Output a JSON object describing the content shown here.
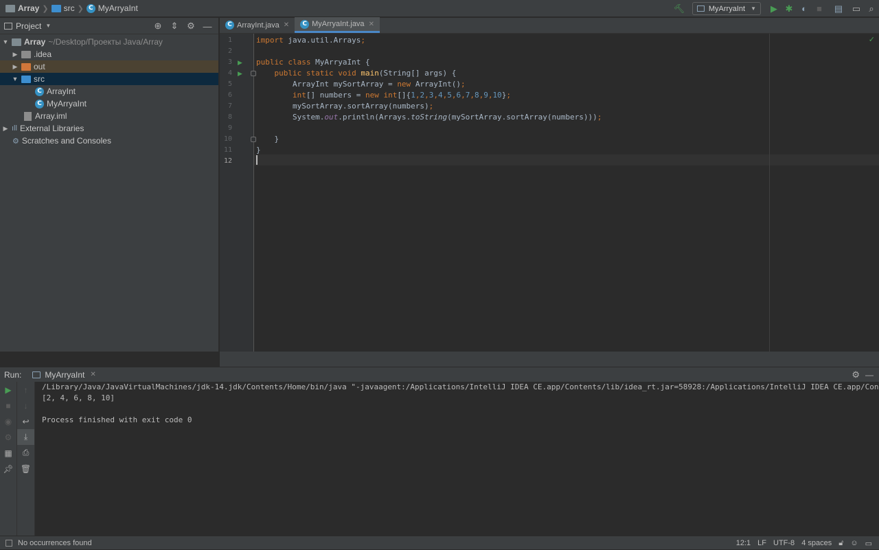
{
  "breadcrumb": {
    "project": "Array",
    "folder": "src",
    "file": "MyArryaInt"
  },
  "toolbar": {
    "run_config": "MyArryaInt"
  },
  "project_panel": {
    "title": "Project",
    "tree": [
      {
        "label": "Array",
        "hint": "~/Desktop/Проекты Java/Array"
      },
      {
        "label": ".idea"
      },
      {
        "label": "out"
      },
      {
        "label": "src"
      },
      {
        "label": "ArrayInt"
      },
      {
        "label": "MyArryaInt"
      },
      {
        "label": "Array.iml"
      },
      {
        "label": "External Libraries"
      },
      {
        "label": "Scratches and Consoles"
      }
    ]
  },
  "editor": {
    "tabs": [
      {
        "label": "ArrayInt.java"
      },
      {
        "label": "MyArryaInt.java"
      }
    ],
    "line_numbers": [
      "1",
      "2",
      "3",
      "4",
      "5",
      "6",
      "7",
      "8",
      "9",
      "10",
      "11",
      "12"
    ]
  },
  "run_panel": {
    "label": "Run:",
    "tab": "MyArryaInt",
    "output": [
      "/Library/Java/JavaVirtualMachines/jdk-14.jdk/Contents/Home/bin/java \"-javaagent:/Applications/IntelliJ IDEA CE.app/Contents/lib/idea_rt.jar=58928:/Applications/IntelliJ IDEA CE.app/Contents/bin\" -",
      "[2, 4, 6, 8, 10]",
      "",
      "Process finished with exit code 0"
    ]
  },
  "status_bar": {
    "message": "No occurrences found",
    "position": "12:1",
    "line_sep": "LF",
    "encoding": "UTF-8",
    "indent": "4 spaces"
  },
  "colors": {
    "keyword": "#cc7832",
    "method": "#ffc66d",
    "number": "#6897bb",
    "static_field": "#9876aa",
    "run_green": "#499c54",
    "selection": "#0d293e"
  }
}
